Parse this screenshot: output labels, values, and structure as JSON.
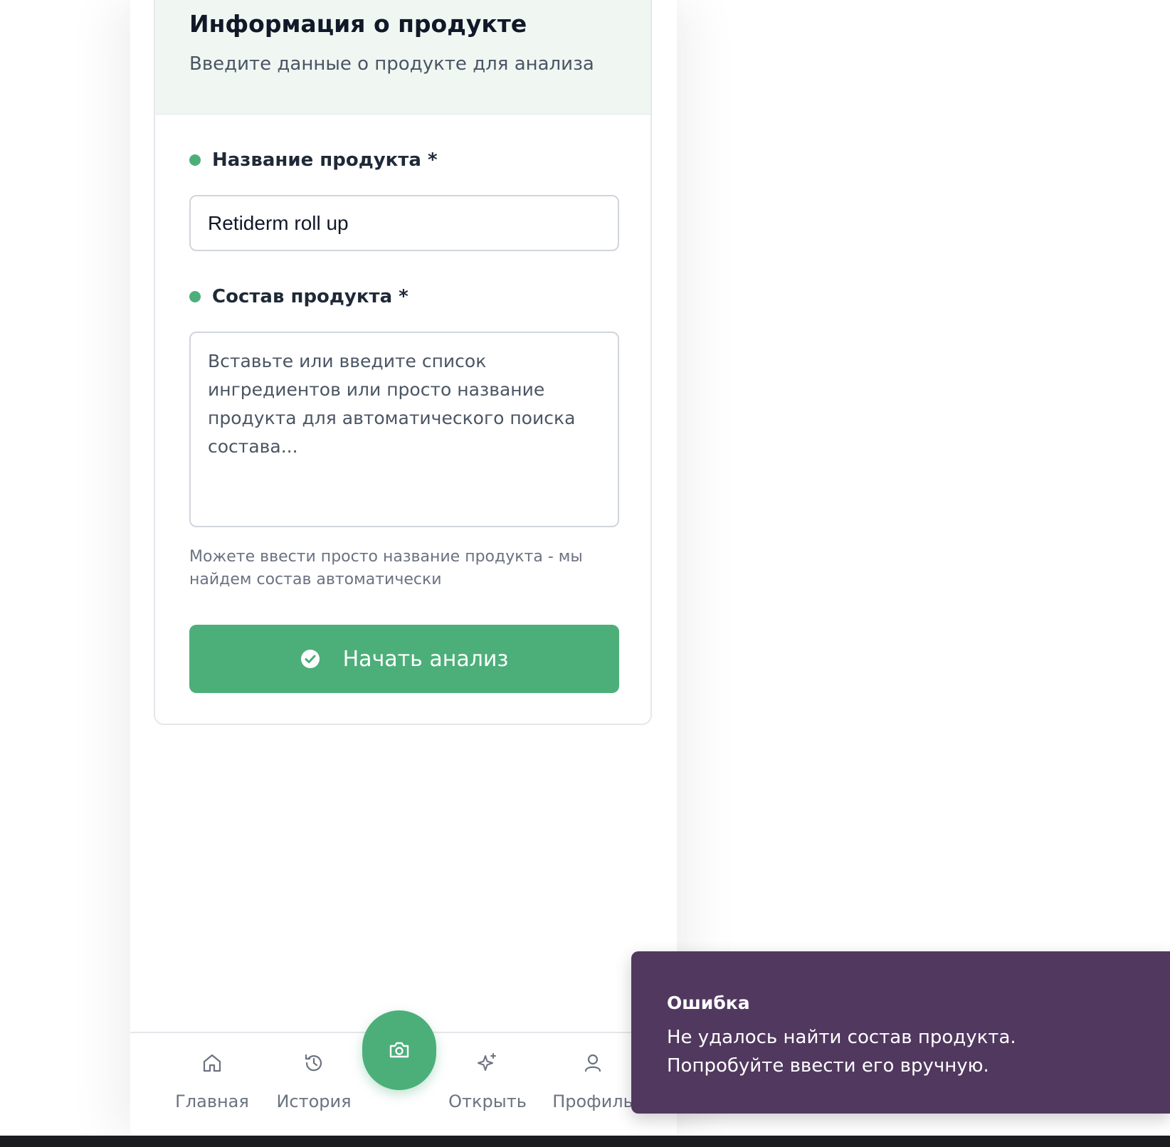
{
  "card": {
    "title": "Информация о продукте",
    "subtitle": "Введите данные о продукте для анализа"
  },
  "form": {
    "name_label": "Название продукта *",
    "name_value": "Retiderm roll up",
    "composition_label": "Состав продукта *",
    "composition_placeholder": "Вставьте или введите список ингредиентов или просто название продукта для автоматического поиска состава...",
    "hint": "Можете ввести просто название продукта - мы найдем состав автоматически",
    "submit_label": "Начать анализ"
  },
  "nav": {
    "items": [
      {
        "label": "Главная",
        "icon": "home-icon"
      },
      {
        "label": "История",
        "icon": "history-icon"
      },
      {
        "label": "Открыть",
        "icon": "sparkles-icon"
      },
      {
        "label": "Профиль",
        "icon": "user-icon"
      }
    ],
    "fab_icon": "camera-icon"
  },
  "toast": {
    "title": "Ошибка",
    "message": "Не удалось найти состав продукта. Попробуйте ввести его вручную."
  },
  "colors": {
    "accent": "#4caf7a",
    "header_bg": "#f0f7f3",
    "toast_bg": "#51385f"
  }
}
